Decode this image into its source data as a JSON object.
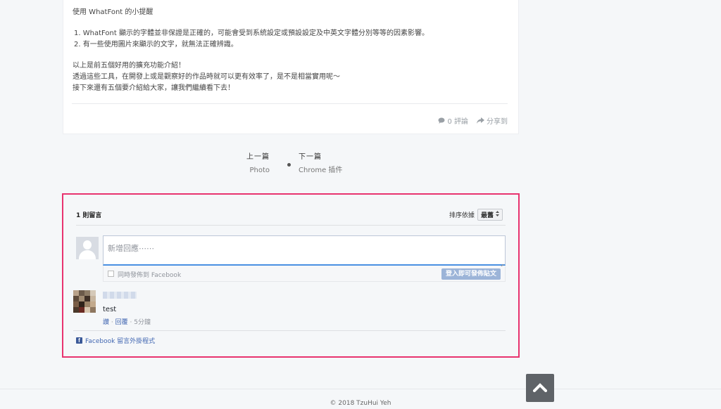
{
  "article": {
    "tips_title": "使用 WhatFont 的小提醒",
    "tips": [
      "1. WhatFont 顯示的字體並非保證是正確的，可能會受到系統設定或預設設定及中英文字體分別等等的因素影響。",
      "2. 有一些使用圖片來顯示的文字，就無法正確辨識。"
    ],
    "para1": "以上是前五個好用的擴充功能介紹！",
    "para2": "透過這些工具，在開發上或是觀察好的作品時就可以更有效率了，是不是相當實用呢～",
    "para3": "接下來還有五個要介紹給大家，讓我們繼續看下去！",
    "comments_link": "0 評論",
    "share_link": "分享到",
    "comment_icon": "comment-icon",
    "share_icon": "share-icon"
  },
  "post_nav": {
    "prev_label": "上一篇",
    "prev_title": "Photo",
    "next_label": "下一篇",
    "next_title": "Chrome 插件"
  },
  "fb_comments": {
    "count_label": "1 則留言",
    "sort_label": "排序依據",
    "sort_value": "最舊",
    "input_placeholder": "新增回應⋯⋯",
    "share_checkbox_label": "同時發佈到 Facebook",
    "post_button": "登入即可發佈貼文",
    "comment": {
      "text": "test",
      "like": "讚",
      "reply": "回覆",
      "time": "5分鐘"
    },
    "plugin_link": "Facebook 留言外掛程式",
    "highlight_color": "#e8336f",
    "link_color": "#4267b2"
  },
  "footer": {
    "copyright": "© 2018 TzuHui Yeh"
  }
}
